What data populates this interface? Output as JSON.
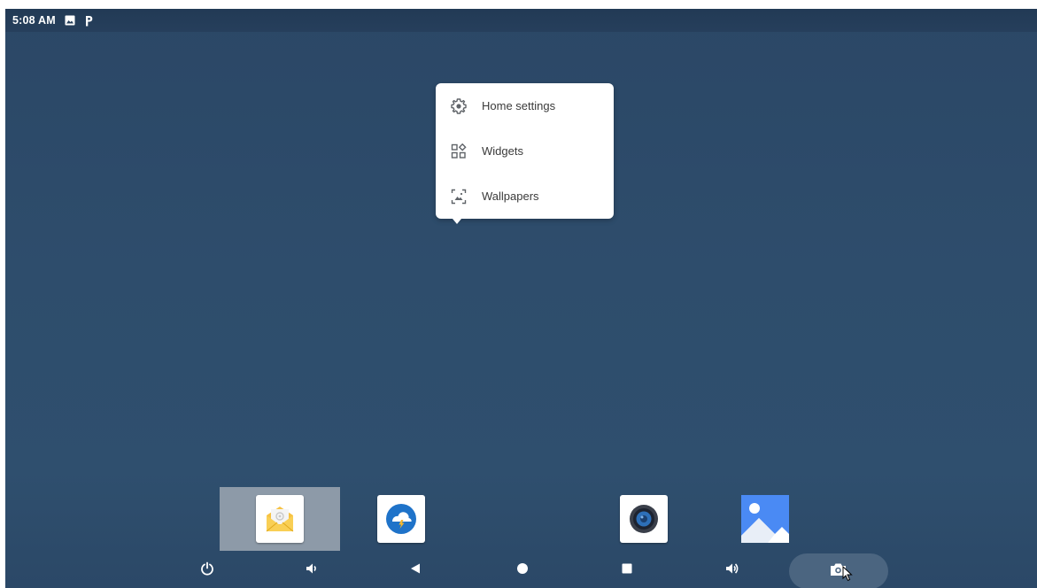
{
  "status_bar": {
    "time": "5:08 AM",
    "icons": [
      "image-notification-icon",
      "p-notification-icon"
    ]
  },
  "popup_menu": {
    "items": [
      {
        "label": "Home settings",
        "icon": "settings-gear-icon"
      },
      {
        "label": "Widgets",
        "icon": "widgets-icon"
      },
      {
        "label": "Wallpapers",
        "icon": "wallpaper-icon"
      }
    ]
  },
  "dock": {
    "apps": [
      {
        "icon": "email-app-icon",
        "selected": true
      },
      {
        "icon": "weather-app-icon"
      },
      {
        "icon": "music-speaker-app-icon"
      },
      {
        "icon": "gallery-app-icon"
      }
    ]
  },
  "nav_bar": {
    "buttons": [
      "power-icon",
      "volume-down-icon",
      "back-icon",
      "home-icon",
      "recents-icon",
      "volume-up-icon",
      "screenshot-camera-icon"
    ]
  },
  "colors": {
    "background": "#2e4d6c",
    "status_bar": "#243d59",
    "selected_slot": "#8d9aa8",
    "screenshot_pill": "#4b6580",
    "menu_bg": "#ffffff"
  }
}
